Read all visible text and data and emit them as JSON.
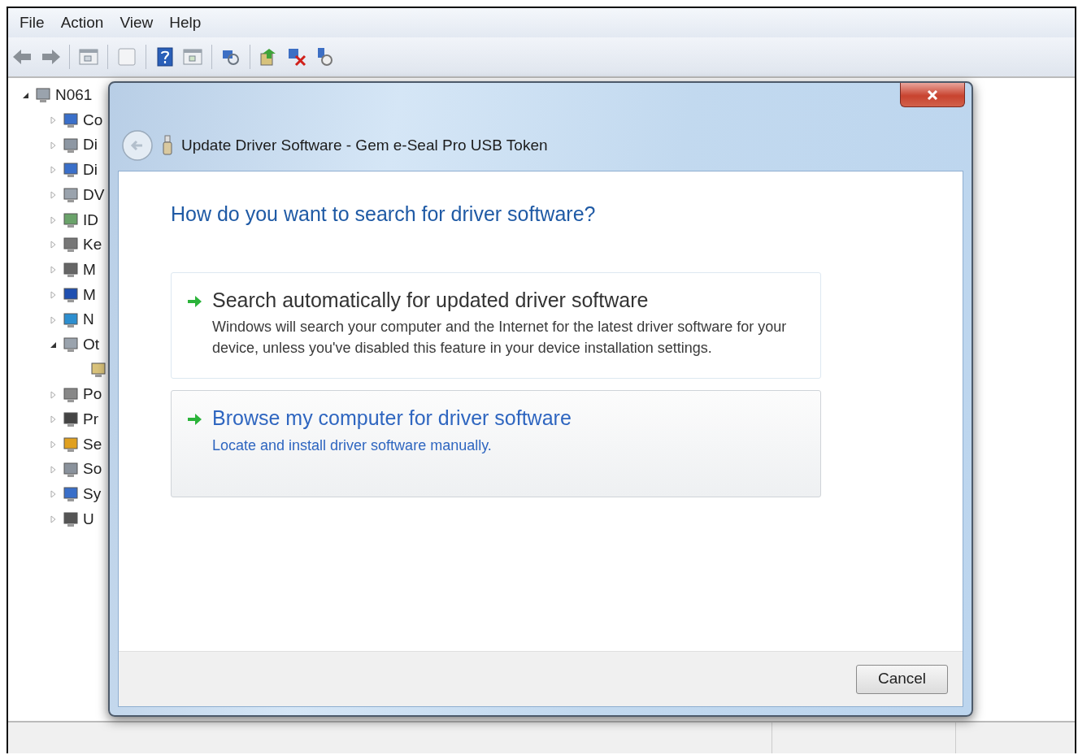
{
  "menu": [
    "File",
    "Action",
    "View",
    "Help"
  ],
  "tree": {
    "label": "N061",
    "expanded": true,
    "children": [
      {
        "label": "Co",
        "expanded": false
      },
      {
        "label": "Di",
        "expanded": false
      },
      {
        "label": "Di",
        "expanded": false
      },
      {
        "label": "DV",
        "expanded": false
      },
      {
        "label": "ID",
        "expanded": false
      },
      {
        "label": "Ke",
        "expanded": false
      },
      {
        "label": "M",
        "expanded": false
      },
      {
        "label": "M",
        "expanded": false
      },
      {
        "label": "N",
        "expanded": false
      },
      {
        "label": "Ot",
        "expanded": true,
        "children": [
          {
            "kind": "device"
          }
        ]
      },
      {
        "label": "Po",
        "expanded": false
      },
      {
        "label": "Pr",
        "expanded": false
      },
      {
        "label": "Se",
        "expanded": false
      },
      {
        "label": "So",
        "expanded": false
      },
      {
        "label": "Sy",
        "expanded": false
      },
      {
        "label": "U",
        "expanded": false
      }
    ]
  },
  "dialog": {
    "title": "Update Driver Software - Gem e-Seal Pro USB Token",
    "heading": "How do you want to search for driver software?",
    "options": [
      {
        "title": "Search automatically for updated driver software",
        "description": "Windows will search your computer and the Internet for the latest driver software for your device, unless you've disabled this feature in your device installation settings.",
        "hovered": false
      },
      {
        "title": "Browse my computer for driver software",
        "description": "Locate and install driver software manually.",
        "hovered": true
      }
    ],
    "buttons": [
      "Cancel"
    ]
  }
}
